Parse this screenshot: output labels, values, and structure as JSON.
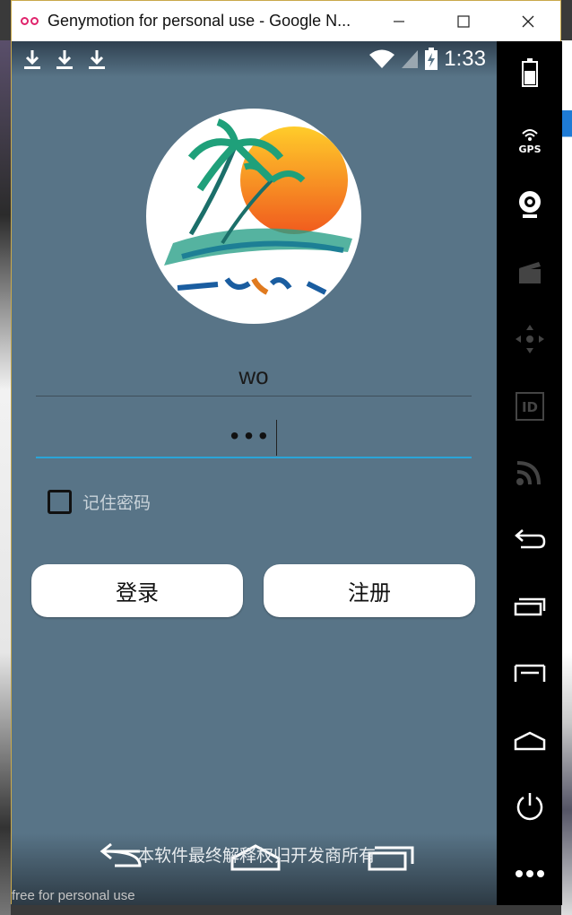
{
  "window": {
    "title": "Genymotion for personal use - Google N...",
    "minimize_icon": "minimize-icon",
    "maximize_icon": "maximize-icon",
    "close_icon": "close-icon"
  },
  "statusbar": {
    "time": "1:33",
    "icons": [
      "download-icon",
      "download-icon",
      "download-icon",
      "wifi-icon",
      "signal-icon",
      "battery-charging-icon"
    ]
  },
  "login": {
    "username": "wo",
    "password_mask": "•••",
    "remember_label": "记住密码",
    "remember_checked": false,
    "login_button": "登录",
    "register_button": "注册"
  },
  "navbar": {
    "watermark": "本软件最终解释权归开发商所有",
    "free_text": "free for personal use"
  },
  "side_panel": {
    "icons": [
      "battery-icon",
      "gps-icon",
      "webcam-icon",
      "clapper-icon",
      "dpad-icon",
      "id-icon",
      "cast-icon",
      "back-icon",
      "recent-apps-icon",
      "menu-icon",
      "home-icon",
      "power-icon",
      "more-icon"
    ],
    "gps_label": "GPS",
    "id_label": "ID"
  },
  "colors": {
    "screen_bg": "#587487",
    "focus_underline": "#2aa5d8",
    "title_icon": "#e0246c"
  }
}
